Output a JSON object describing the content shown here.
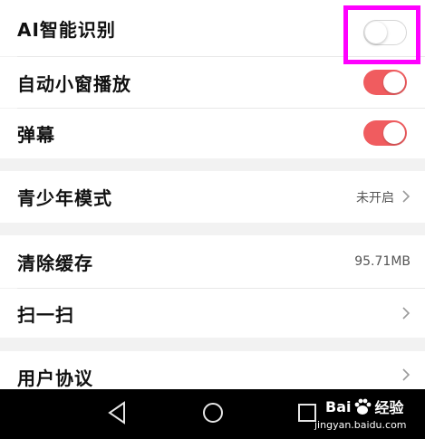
{
  "settings": {
    "ai_recognition": {
      "label": "AI智能识别",
      "toggle_state": "off"
    },
    "auto_mini_window": {
      "label": "自动小窗播放",
      "toggle_state": "on"
    },
    "danmaku": {
      "label": "弹幕",
      "toggle_state": "on"
    },
    "teen_mode": {
      "label": "青少年模式",
      "value": "未开启"
    },
    "clear_cache": {
      "label": "清除缓存",
      "value": "95.71MB"
    },
    "scan": {
      "label": "扫一扫"
    },
    "user_agreement": {
      "label": "用户协议"
    }
  },
  "navbar": {
    "buttons": [
      "back-icon",
      "home-icon",
      "recents-icon"
    ]
  },
  "watermark": {
    "logo": "Bai",
    "logo_suffix": "经验",
    "url": "jingyan.baidu.com"
  },
  "colors": {
    "toggle_on": "#f05c5f",
    "highlight": "#ff00ff",
    "background": "#f2f2f2",
    "navbar": "#000000"
  }
}
